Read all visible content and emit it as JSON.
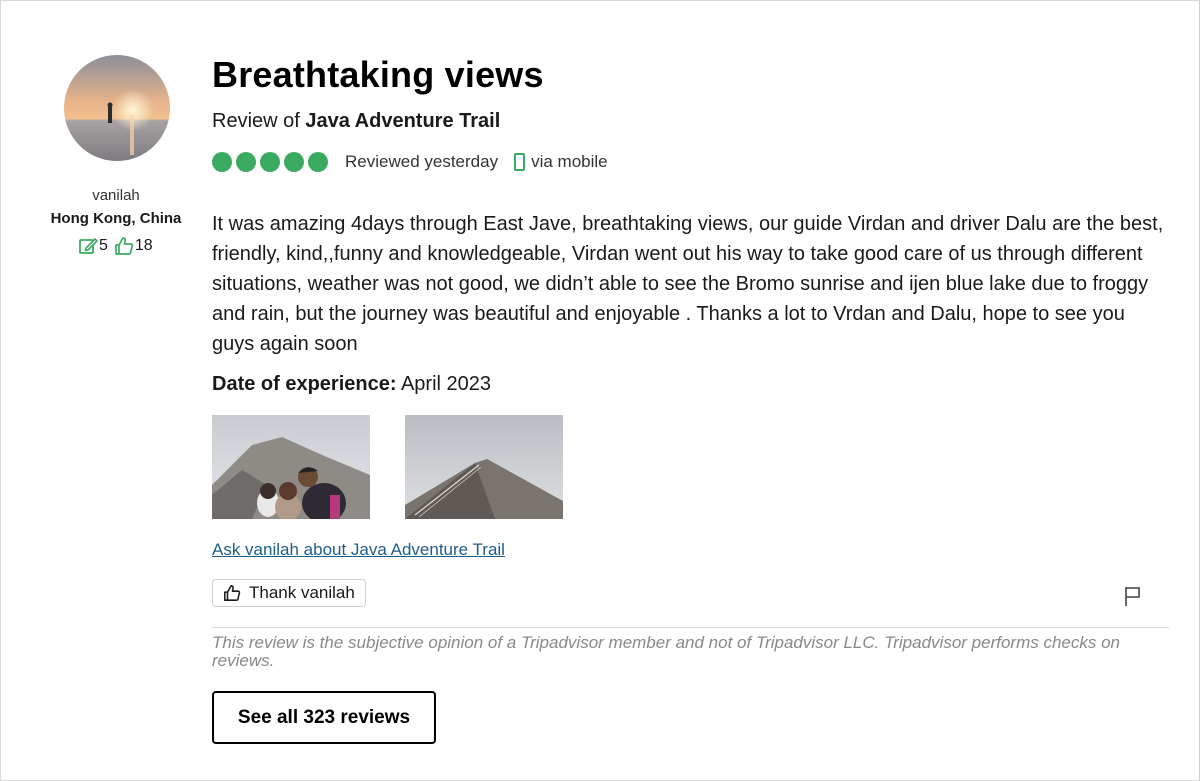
{
  "reviewer": {
    "username": "vanilah",
    "location": "Hong Kong, China",
    "contributions": "5",
    "helpful_votes": "18"
  },
  "review": {
    "title": "Breathtaking views",
    "subtitle_prefix": "Review of ",
    "attraction": "Java Adventure Trail",
    "rating_bubbles": 5,
    "reviewed": "Reviewed yesterday",
    "via": "via mobile",
    "body": "It was amazing 4days through East Jave, breathtaking views, our guide Virdan and driver Dalu are the best, friendly, kind,,funny and knowledgeable, Virdan went out his way to take good care of us through different situations, weather was not good, we didn’t able to see the Bromo sunrise and ijen blue lake due to froggy and rain, but the journey was beautiful and enjoyable . Thanks a lot to Vrdan and Dalu, hope to see you guys again soon",
    "date_label": "Date of experience:",
    "date_value": "April 2023"
  },
  "actions": {
    "ask_link": "Ask vanilah about Java Adventure Trail",
    "thank_button": "Thank vanilah",
    "see_all": "See all 323 reviews"
  },
  "disclaimer": "This review is the subjective opinion of a Tripadvisor member and not of Tripadvisor LLC. Tripadvisor performs checks on reviews.",
  "colors": {
    "bubble_green": "#3cab62",
    "link_blue": "#1f5d8a"
  },
  "icons": [
    "pencil-icon",
    "thumbs-up-icon",
    "phone-icon",
    "flag-icon"
  ]
}
